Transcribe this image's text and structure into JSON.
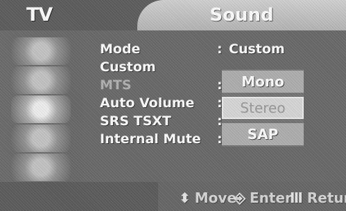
{
  "osd": {
    "left_title": "TV",
    "tab_title": "Sound"
  },
  "menu": {
    "items": [
      {
        "label": "Mode",
        "value": "Custom",
        "disabled": false
      },
      {
        "label": "Custom",
        "value": "",
        "disabled": false
      },
      {
        "label": "MTS",
        "value": "",
        "disabled": true
      },
      {
        "label": "Auto Volume",
        "value": "",
        "disabled": false
      },
      {
        "label": "SRS TSXT",
        "value": "",
        "disabled": false
      },
      {
        "label": "Internal Mute",
        "value": "",
        "disabled": false
      }
    ],
    "colon": ":"
  },
  "dropdown": {
    "options": [
      "Mono",
      "Stereo",
      "SAP"
    ],
    "selected": "Stereo"
  },
  "footer": {
    "move_icon": "updown-arrows-icon",
    "move_label": "Move",
    "enter_icon": "enter-icon",
    "enter_label": "Enter",
    "return_icon": "return-icon",
    "return_label": "Return"
  }
}
